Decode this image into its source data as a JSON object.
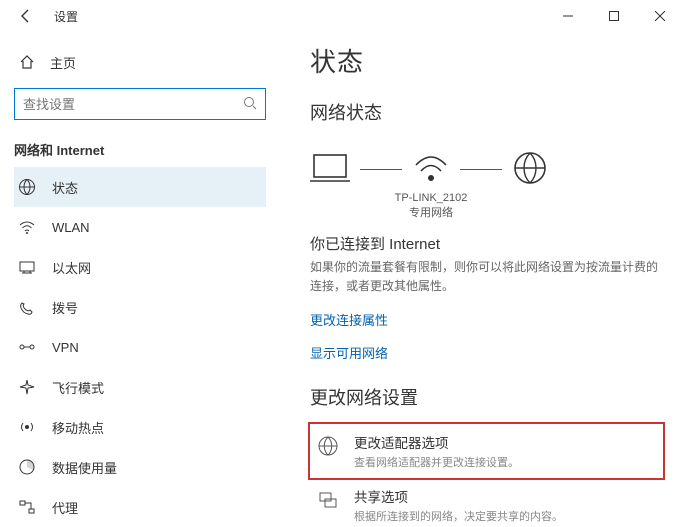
{
  "window": {
    "title": "设置"
  },
  "sidebar": {
    "home_label": "主页",
    "search_placeholder": "查找设置",
    "group_header": "网络和 Internet",
    "items": [
      {
        "label": "状态"
      },
      {
        "label": "WLAN"
      },
      {
        "label": "以太网"
      },
      {
        "label": "拨号"
      },
      {
        "label": "VPN"
      },
      {
        "label": "飞行模式"
      },
      {
        "label": "移动热点"
      },
      {
        "label": "数据使用量"
      },
      {
        "label": "代理"
      }
    ]
  },
  "main": {
    "page_title": "状态",
    "section_net_status": "网络状态",
    "ap_name": "TP-LINK_2102",
    "ap_type": "专用网络",
    "connected_heading": "你已连接到 Internet",
    "connected_desc": "如果你的流量套餐有限制，则你可以将此网络设置为按流量计费的连接，或者更改其他属性。",
    "link_change_props": "更改连接属性",
    "link_show_networks": "显示可用网络",
    "section_change": "更改网络设置",
    "options": [
      {
        "title": "更改适配器选项",
        "desc": "查看网络适配器并更改连接设置。"
      },
      {
        "title": "共享选项",
        "desc": "根据所连接到的网络，决定要共享的内容。"
      }
    ]
  }
}
